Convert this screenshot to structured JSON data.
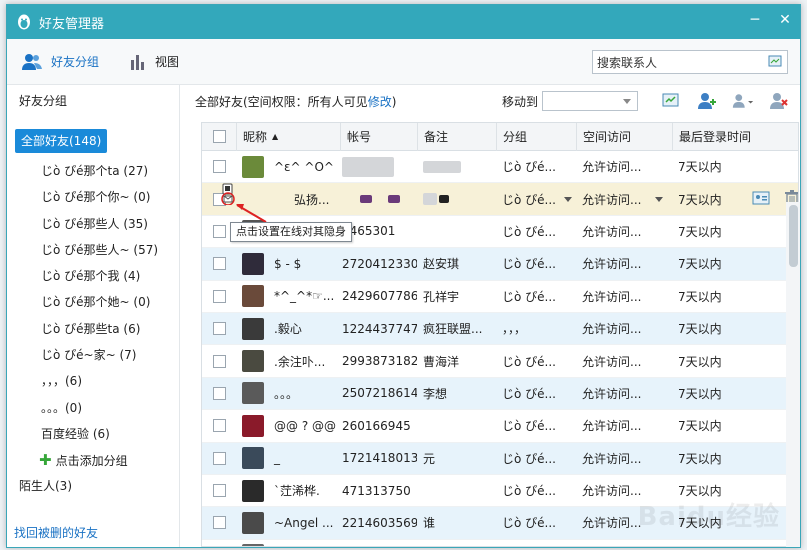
{
  "window": {
    "title": "好友管理器",
    "controls": [
      "minimize",
      "close"
    ]
  },
  "toolbar": {
    "tab_groups": "好友分组",
    "tab_view": "视图",
    "search_placeholder": "搜索联系人"
  },
  "sidebar": {
    "header": "好友分组",
    "all_friends": "全部好友(148)",
    "groups": [
      "じò ぴé那个ta (27)",
      "じò ぴé那个你~ (0)",
      "じò ぴé那些人 (35)",
      "じò ぴé那些人~ (57)",
      "じò ぴé那个我 (4)",
      "じò ぴé那个她~ (0)",
      "じò ぴé那些ta (6)",
      "じò ぴé~家~ (7)",
      "，，，(6)",
      "。。。(0)",
      "百度经验 (6)"
    ],
    "add_group": "点击添加分组",
    "strangers": "陌生人(3)",
    "recover": "找回被删的好友"
  },
  "main": {
    "title": "全部好友(空间权限：所有人可见",
    "title_link": "修改",
    "title_end": ")",
    "move_to": "移动到",
    "columns": [
      "昵称",
      "帐号",
      "备注",
      "分组",
      "空间访问",
      "最后登录时间"
    ],
    "rows": [
      {
        "nick": "^ε^ ^O^",
        "account": "",
        "remark": "",
        "group": "じò ぴé...",
        "space": "允许访问...",
        "last": "7天以内",
        "avatar": "#6b8a3a"
      },
      {
        "nick": "弘扬...",
        "account": "",
        "remark": "",
        "group": "じò ぴé...",
        "space": "允许访问...",
        "last": "7天以内",
        "avatar": "#8a3a5b"
      },
      {
        "nick": "",
        "account": "9465301",
        "remark": "",
        "group": "じò ぴé...",
        "space": "允许访问...",
        "last": "7天以内",
        "avatar": "#555555"
      },
      {
        "nick": "$ - $",
        "account": "2720412330",
        "remark": "赵安琪",
        "group": "じò ぴé...",
        "space": "允许访问...",
        "last": "7天以内",
        "avatar": "#2f2b3a"
      },
      {
        "nick": "*^_^*☞...",
        "account": "2429607786",
        "remark": "孔祥宇",
        "group": "じò ぴé...",
        "space": "允许访问...",
        "last": "7天以内",
        "avatar": "#6a4a3a"
      },
      {
        "nick": ".毅心",
        "account": "1224437747",
        "remark": "疯狂联盟...",
        "group": "，，，",
        "space": "允许访问...",
        "last": "7天以内",
        "avatar": "#3a3a3a"
      },
      {
        "nick": ".余注卟...",
        "account": "2993873182",
        "remark": "曹海洋",
        "group": "じò ぴé...",
        "space": "允许访问...",
        "last": "7天以内",
        "avatar": "#4a4a40"
      },
      {
        "nick": "。。。",
        "account": "2507218614",
        "remark": "李想",
        "group": "じò ぴé...",
        "space": "允许访问...",
        "last": "7天以内",
        "avatar": "#5a5a5a"
      },
      {
        "nick": "@@ ? @@",
        "account": "260166945",
        "remark": "",
        "group": "じò ぴé...",
        "space": "允许访问...",
        "last": "7天以内",
        "avatar": "#8a1a2a"
      },
      {
        "nick": "_",
        "account": "1721418013",
        "remark": "元",
        "group": "じò ぴé...",
        "space": "允许访问...",
        "last": "7天以内",
        "avatar": "#3a4a5a"
      },
      {
        "nick": "`茳浠桦.",
        "account": "471313750",
        "remark": "",
        "group": "じò ぴé...",
        "space": "允许访问...",
        "last": "7天以内",
        "avatar": "#2a2a2a"
      },
      {
        "nick": "~Angel ...",
        "account": "2214603569",
        "remark": "谁",
        "group": "じò ぴé...",
        "space": "允许访问...",
        "last": "7天以内",
        "avatar": "#4a4a4a"
      },
      {
        "nick": "",
        "account": "",
        "remark": "",
        "group": "",
        "space": "",
        "last": "",
        "avatar": "#666666"
      }
    ]
  },
  "tooltip": "点击设置在线对其隐身",
  "watermark": "Baidu经验",
  "colors": {
    "titlebar": "#33a8bb",
    "accent": "#1a8ad9",
    "link": "#1a72c4",
    "highlight_row": "#f7f1d8",
    "alt_row": "#e7f3fb"
  }
}
